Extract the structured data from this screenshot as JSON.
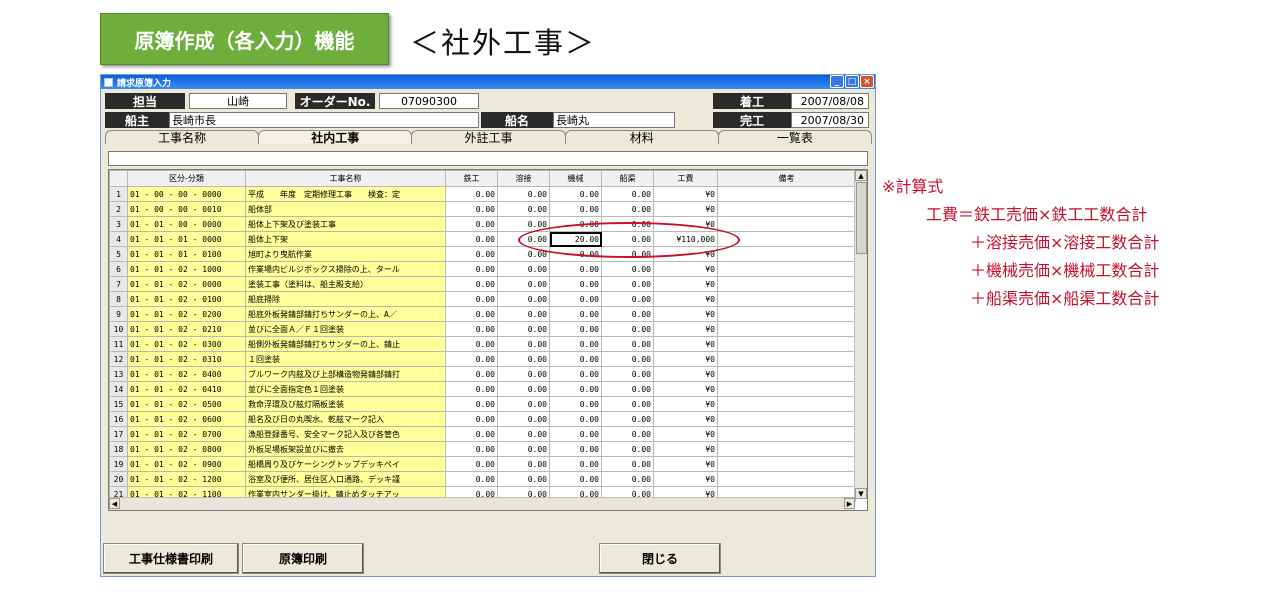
{
  "slide": {
    "badge": "原簿作成（各入力）機能",
    "subtitle": "＜社外工事＞"
  },
  "window": {
    "title": "請求原簿入力",
    "controls": {
      "minimize": "_",
      "maximize": "□",
      "close": "×"
    }
  },
  "header": {
    "tanto_label": "担当",
    "tanto_value": "山崎",
    "order_label": "オーダーNo.",
    "order_value": "07090300",
    "chakko_label": "着工",
    "chakko_value": "2007/08/08",
    "senshu_label": "船主",
    "senshu_value": "長崎市長",
    "senmei_label": "船名",
    "senmei_value": "長崎丸",
    "kanko_label": "完工",
    "kanko_value": "2007/08/30"
  },
  "tabs": [
    "工事名称",
    "社内工事",
    "外註工事",
    "材料",
    "一覧表"
  ],
  "active_tab": "社内工事",
  "grid": {
    "columns": [
      "",
      "区分-分類",
      "工事名称",
      "鉄工",
      "溶接",
      "機械",
      "船渠",
      "工費",
      "備考"
    ],
    "rows": [
      {
        "no": "1",
        "code": "01 - 00 - 00 - 0000",
        "name": "平成　　年度　定期修理工事　　検査：定",
        "tekko": "0.00",
        "yosetsu": "0.00",
        "kikai": "0.00",
        "senkyo": "0.00",
        "kohi": "¥0",
        "biko": ""
      },
      {
        "no": "2",
        "code": "01 - 00 - 00 - 0010",
        "name": "船体部",
        "tekko": "0.00",
        "yosetsu": "0.00",
        "kikai": "0.00",
        "senkyo": "0.00",
        "kohi": "¥0",
        "biko": ""
      },
      {
        "no": "3",
        "code": "01 - 01 - 00 - 0000",
        "name": "船体上下架及び塗装工事",
        "tekko": "0.00",
        "yosetsu": "0.00",
        "kikai": "0.00",
        "senkyo": "0.00",
        "kohi": "¥0",
        "biko": ""
      },
      {
        "no": "4",
        "code": "01 - 01 - 01 - 0000",
        "name": "船体上下架",
        "tekko": "0.00",
        "yosetsu": "0.00",
        "kikai": "20.00",
        "senkyo": "0.00",
        "kohi": "¥110,000",
        "biko": ""
      },
      {
        "no": "5",
        "code": "01 - 01 - 01 - 0100",
        "name": "旭町より曳航作業",
        "tekko": "0.00",
        "yosetsu": "0.00",
        "kikai": "0.00",
        "senkyo": "0.00",
        "kohi": "¥0",
        "biko": ""
      },
      {
        "no": "6",
        "code": "01 - 01 - 02 - 1000",
        "name": "作業場内ビルジボックス掃除の上、タール",
        "tekko": "0.00",
        "yosetsu": "0.00",
        "kikai": "0.00",
        "senkyo": "0.00",
        "kohi": "¥0",
        "biko": ""
      },
      {
        "no": "7",
        "code": "01 - 01 - 02 - 0000",
        "name": "塗装工事（塗料は、船主殿支給）",
        "tekko": "0.00",
        "yosetsu": "0.00",
        "kikai": "0.00",
        "senkyo": "0.00",
        "kohi": "¥0",
        "biko": ""
      },
      {
        "no": "8",
        "code": "01 - 01 - 02 - 0100",
        "name": "船底掃除",
        "tekko": "0.00",
        "yosetsu": "0.00",
        "kikai": "0.00",
        "senkyo": "0.00",
        "kohi": "¥0",
        "biko": ""
      },
      {
        "no": "9",
        "code": "01 - 01 - 02 - 0200",
        "name": "船底外板発錆部錆打ちサンダーの上、A／",
        "tekko": "0.00",
        "yosetsu": "0.00",
        "kikai": "0.00",
        "senkyo": "0.00",
        "kohi": "¥0",
        "biko": ""
      },
      {
        "no": "10",
        "code": "01 - 01 - 02 - 0210",
        "name": "並びに全面Ａ／Ｆ１回塗装",
        "tekko": "0.00",
        "yosetsu": "0.00",
        "kikai": "0.00",
        "senkyo": "0.00",
        "kohi": "¥0",
        "biko": ""
      },
      {
        "no": "11",
        "code": "01 - 01 - 02 - 0300",
        "name": "船側外板発錆部錆打ちサンダーの上、錆止",
        "tekko": "0.00",
        "yosetsu": "0.00",
        "kikai": "0.00",
        "senkyo": "0.00",
        "kohi": "¥0",
        "biko": ""
      },
      {
        "no": "12",
        "code": "01 - 01 - 02 - 0310",
        "name": "１回塗装",
        "tekko": "0.00",
        "yosetsu": "0.00",
        "kikai": "0.00",
        "senkyo": "0.00",
        "kohi": "¥0",
        "biko": ""
      },
      {
        "no": "13",
        "code": "01 - 01 - 02 - 0400",
        "name": "ブルワーク内舷及び上部構造物発錆部錆打",
        "tekko": "0.00",
        "yosetsu": "0.00",
        "kikai": "0.00",
        "senkyo": "0.00",
        "kohi": "¥0",
        "biko": ""
      },
      {
        "no": "14",
        "code": "01 - 01 - 02 - 0410",
        "name": "並びに全面指定色１回塗装",
        "tekko": "0.00",
        "yosetsu": "0.00",
        "kikai": "0.00",
        "senkyo": "0.00",
        "kohi": "¥0",
        "biko": ""
      },
      {
        "no": "15",
        "code": "01 - 01 - 02 - 0500",
        "name": "救命浮環及び舷灯隔板塗装",
        "tekko": "0.00",
        "yosetsu": "0.00",
        "kikai": "0.00",
        "senkyo": "0.00",
        "kohi": "¥0",
        "biko": ""
      },
      {
        "no": "16",
        "code": "01 - 01 - 02 - 0600",
        "name": "船名及び日の丸喫水、乾舷マーク記入",
        "tekko": "0.00",
        "yosetsu": "0.00",
        "kikai": "0.00",
        "senkyo": "0.00",
        "kohi": "¥0",
        "biko": ""
      },
      {
        "no": "17",
        "code": "01 - 01 - 02 - 0700",
        "name": "漁船登録番号、安全マーク記入及び各管色",
        "tekko": "0.00",
        "yosetsu": "0.00",
        "kikai": "0.00",
        "senkyo": "0.00",
        "kohi": "¥0",
        "biko": ""
      },
      {
        "no": "18",
        "code": "01 - 01 - 02 - 0800",
        "name": "外板足場板架設並びに撤去",
        "tekko": "0.00",
        "yosetsu": "0.00",
        "kikai": "0.00",
        "senkyo": "0.00",
        "kohi": "¥0",
        "biko": ""
      },
      {
        "no": "19",
        "code": "01 - 01 - 02 - 0900",
        "name": "船橋周り及びケーシングトップデッキペイ",
        "tekko": "0.00",
        "yosetsu": "0.00",
        "kikai": "0.00",
        "senkyo": "0.00",
        "kohi": "¥0",
        "biko": ""
      },
      {
        "no": "20",
        "code": "01 - 01 - 02 - 1200",
        "name": "浴室及び便所、居住区入口通路、デッキ謹",
        "tekko": "0.00",
        "yosetsu": "0.00",
        "kikai": "0.00",
        "senkyo": "0.00",
        "kohi": "¥0",
        "biko": ""
      },
      {
        "no": "21",
        "code": "01 - 01 - 02 - 1100",
        "name": "作業室内サンダー掛け、錆止めタッチアッ",
        "tekko": "0.00",
        "yosetsu": "0.00",
        "kikai": "0.00",
        "senkyo": "0.00",
        "kohi": "¥0",
        "biko": ""
      }
    ]
  },
  "buttons": {
    "spec_print": "工事仕様書印刷",
    "ledger_print": "原簿印刷",
    "close": "閉じる"
  },
  "formula": {
    "heading": "※計算式",
    "line1": "工費＝鉄工売価×鉄工工数合計",
    "line2": "＋溶接売価×溶接工数合計",
    "line3": "＋機械売価×機械工数合計",
    "line4": "＋船渠売価×船渠工数合計"
  },
  "colors": {
    "badge": "#6fae3c",
    "highlight_ellipse": "#c8102e",
    "yellow_column": "#ffff99"
  }
}
